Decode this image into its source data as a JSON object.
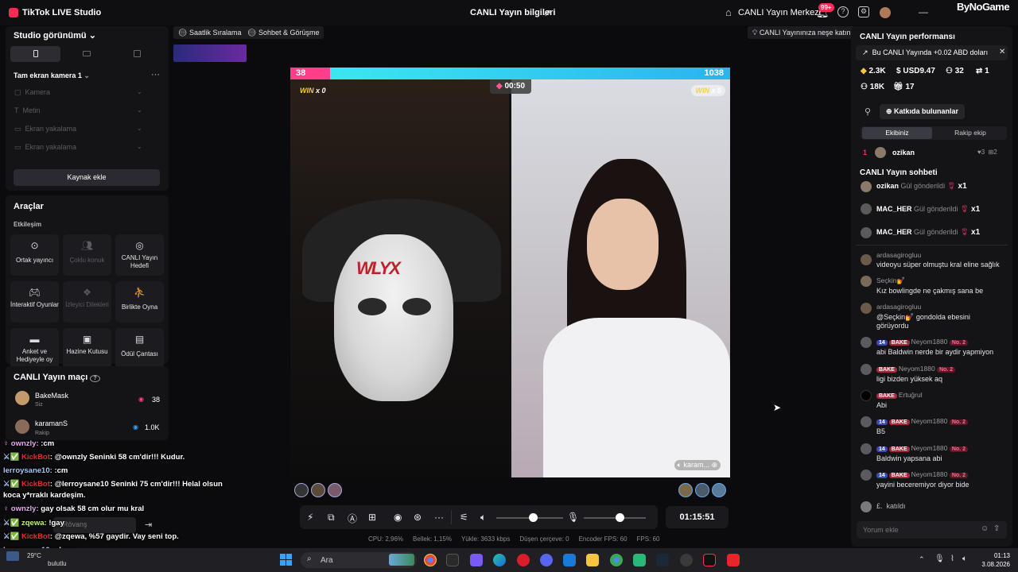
{
  "titlebar": {
    "app_title": "TikTok LIVE Studio",
    "center_title": "CANLI Yayın bilgileri",
    "live_center_label": "CANLI Yayın Merkezi",
    "notif_count": "99+",
    "watermark": "ByNoGame"
  },
  "left": {
    "studio_view": "Studio görünümü",
    "scene_name": "Tam ekran kamera 1",
    "sources": [
      "Kamera",
      "Metin",
      "Ekran yakalama",
      "Ekran yakalama"
    ],
    "add_source": "Kaynak ekle",
    "tools_title": "Araçlar",
    "interaction_title": "Etkileşim",
    "tools": [
      {
        "label": "Ortak yayıncı",
        "disabled": false
      },
      {
        "label": "Çoklu konuk",
        "disabled": true
      },
      {
        "label": "CANLI Yayın Hedefi",
        "disabled": false
      },
      {
        "label": "İnteraktif Oyunlar",
        "disabled": false
      },
      {
        "label": "İzleyici Dilekleri",
        "disabled": true
      },
      {
        "label": "Birlikte Oyna",
        "disabled": false
      },
      {
        "label": "Anket ve Hediyeyle oy",
        "disabled": false
      },
      {
        "label": "Hazine Kutusu",
        "disabled": false
      },
      {
        "label": "Ödül Çantası",
        "disabled": false
      }
    ],
    "match_title": "CANLI Yayın maçı",
    "match": [
      {
        "name": "BakeMask",
        "role": "Siz",
        "score": "38"
      },
      {
        "name": "karamanS",
        "role": "Rakip",
        "score": "1.0K"
      }
    ]
  },
  "overlay_chat": [
    {
      "user": "ownzly",
      "text": ":cm"
    },
    {
      "user": "KickBot",
      "text": "@ownzly Seninki 58 cm'dir!!! Kudur."
    },
    {
      "user": "lerroysane10",
      "text": ":cm"
    },
    {
      "user": "KickBot",
      "text": "@lerroysane10 Seninki 75 cm'dir!!! Helal olsun"
    },
    {
      "user": "",
      "text": "koca y*rraklı kardeşim."
    },
    {
      "user": "ownzly",
      "text": "gay olsak 58 cm olur mu kral"
    },
    {
      "user": "zqewa",
      "text": "!gay"
    },
    {
      "user": "KickBot",
      "text": "@zqewa, %57 gaydir. Vay seni top."
    },
    {
      "user": "lerroysane10",
      "text": "ohaaa"
    },
    {
      "user": "zqewa",
      "text": ""
    }
  ],
  "overlay_misc": {
    "leave_label": "Rövanş",
    "weather_temp": "29°C",
    "weather_desc": "bulutlu"
  },
  "top_chips": {
    "hourly_ranking": "Saatlik Sıralama",
    "chat_meet": "Sohbet & Görüşme",
    "join_fun": "CANLI Yayınınıza neşe katın"
  },
  "stream": {
    "left_score": "38",
    "right_score": "1038",
    "timer": "00:50",
    "win_left_prefix": "WIN",
    "win_left": "x 0",
    "win_right_prefix": "WIN",
    "win_right": "x 5",
    "right_cam_label": "karam...",
    "mask_text": "WLYX"
  },
  "controls": {
    "elapsed": "01:15:51",
    "stats": [
      "CPU: 2,96%",
      "Bellek: 1,15%",
      "Yükle: 3633 kbps",
      "Düşen çerçeve: 0",
      "Encoder FPS: 60",
      "FPS: 60"
    ]
  },
  "right": {
    "perf_title": "CANLI Yayın performansı",
    "earn_banner": "Bu CANLI Yayında +0.02 ABD doları",
    "stats_row1": [
      "2.3K",
      "USD9.47",
      "32",
      "1"
    ],
    "stats_row2": [
      "18K",
      "17"
    ],
    "contributors_btn": "Katkıda bulunanlar",
    "tab_my_team": "Ekibiniz",
    "tab_rival": "Rakip ekip",
    "top_contrib": {
      "rank": "1",
      "name": "ozikan",
      "hearts": "3",
      "gifts": "2"
    },
    "chat_title": "CANLI Yayın sohbeti",
    "gifts": [
      {
        "name": "ozikan",
        "action": "Gül gönderildi",
        "count": "x1"
      },
      {
        "name": "MAC_HER",
        "action": "Gül gönderildi",
        "count": "x1"
      },
      {
        "name": "MAC_HER",
        "action": "Gül gönderildi",
        "count": "x1"
      }
    ],
    "chat": [
      {
        "name": "ardasagirogluu",
        "tags": [],
        "text": "videoyu süper olmuştu kral eline sağlık"
      },
      {
        "name": "Seçkin💅",
        "tags": [],
        "text": "Kız bowlingde ne çakmış sana be"
      },
      {
        "name": "ardasagirogluu",
        "tags": [],
        "text": "@Seçkin💅 gondolda ebesini görüyordu"
      },
      {
        "name": "Neyom1880",
        "tags": [
          "14",
          "BAKE",
          "No. 2"
        ],
        "text": "abi Baldwin nerde bir aydir yapmiyon"
      },
      {
        "name": "Neyom1880",
        "tags": [
          "BAKE",
          "No. 2"
        ],
        "text": "ligi bizden yüksek aq"
      },
      {
        "name": "Ertuğrul",
        "tags": [
          "BAKE"
        ],
        "text": "Abi"
      },
      {
        "name": "Neyom1880",
        "tags": [
          "14",
          "BAKE",
          "No. 2"
        ],
        "text": "B5"
      },
      {
        "name": "Neyom1880",
        "tags": [
          "14",
          "BAKE",
          "No. 2"
        ],
        "text": "Baldwin yapsana abi"
      },
      {
        "name": "Neyom1880",
        "tags": [
          "14",
          "BAKE",
          "No. 2"
        ],
        "text": "yayini beceremiyor diyor bide"
      }
    ],
    "joined_name": "£.",
    "joined_text": "katıldı",
    "comment_placeholder": "Yorum ekle"
  },
  "taskbar": {
    "search": "Ara",
    "time": "01:13",
    "date": "3.08.2026"
  }
}
